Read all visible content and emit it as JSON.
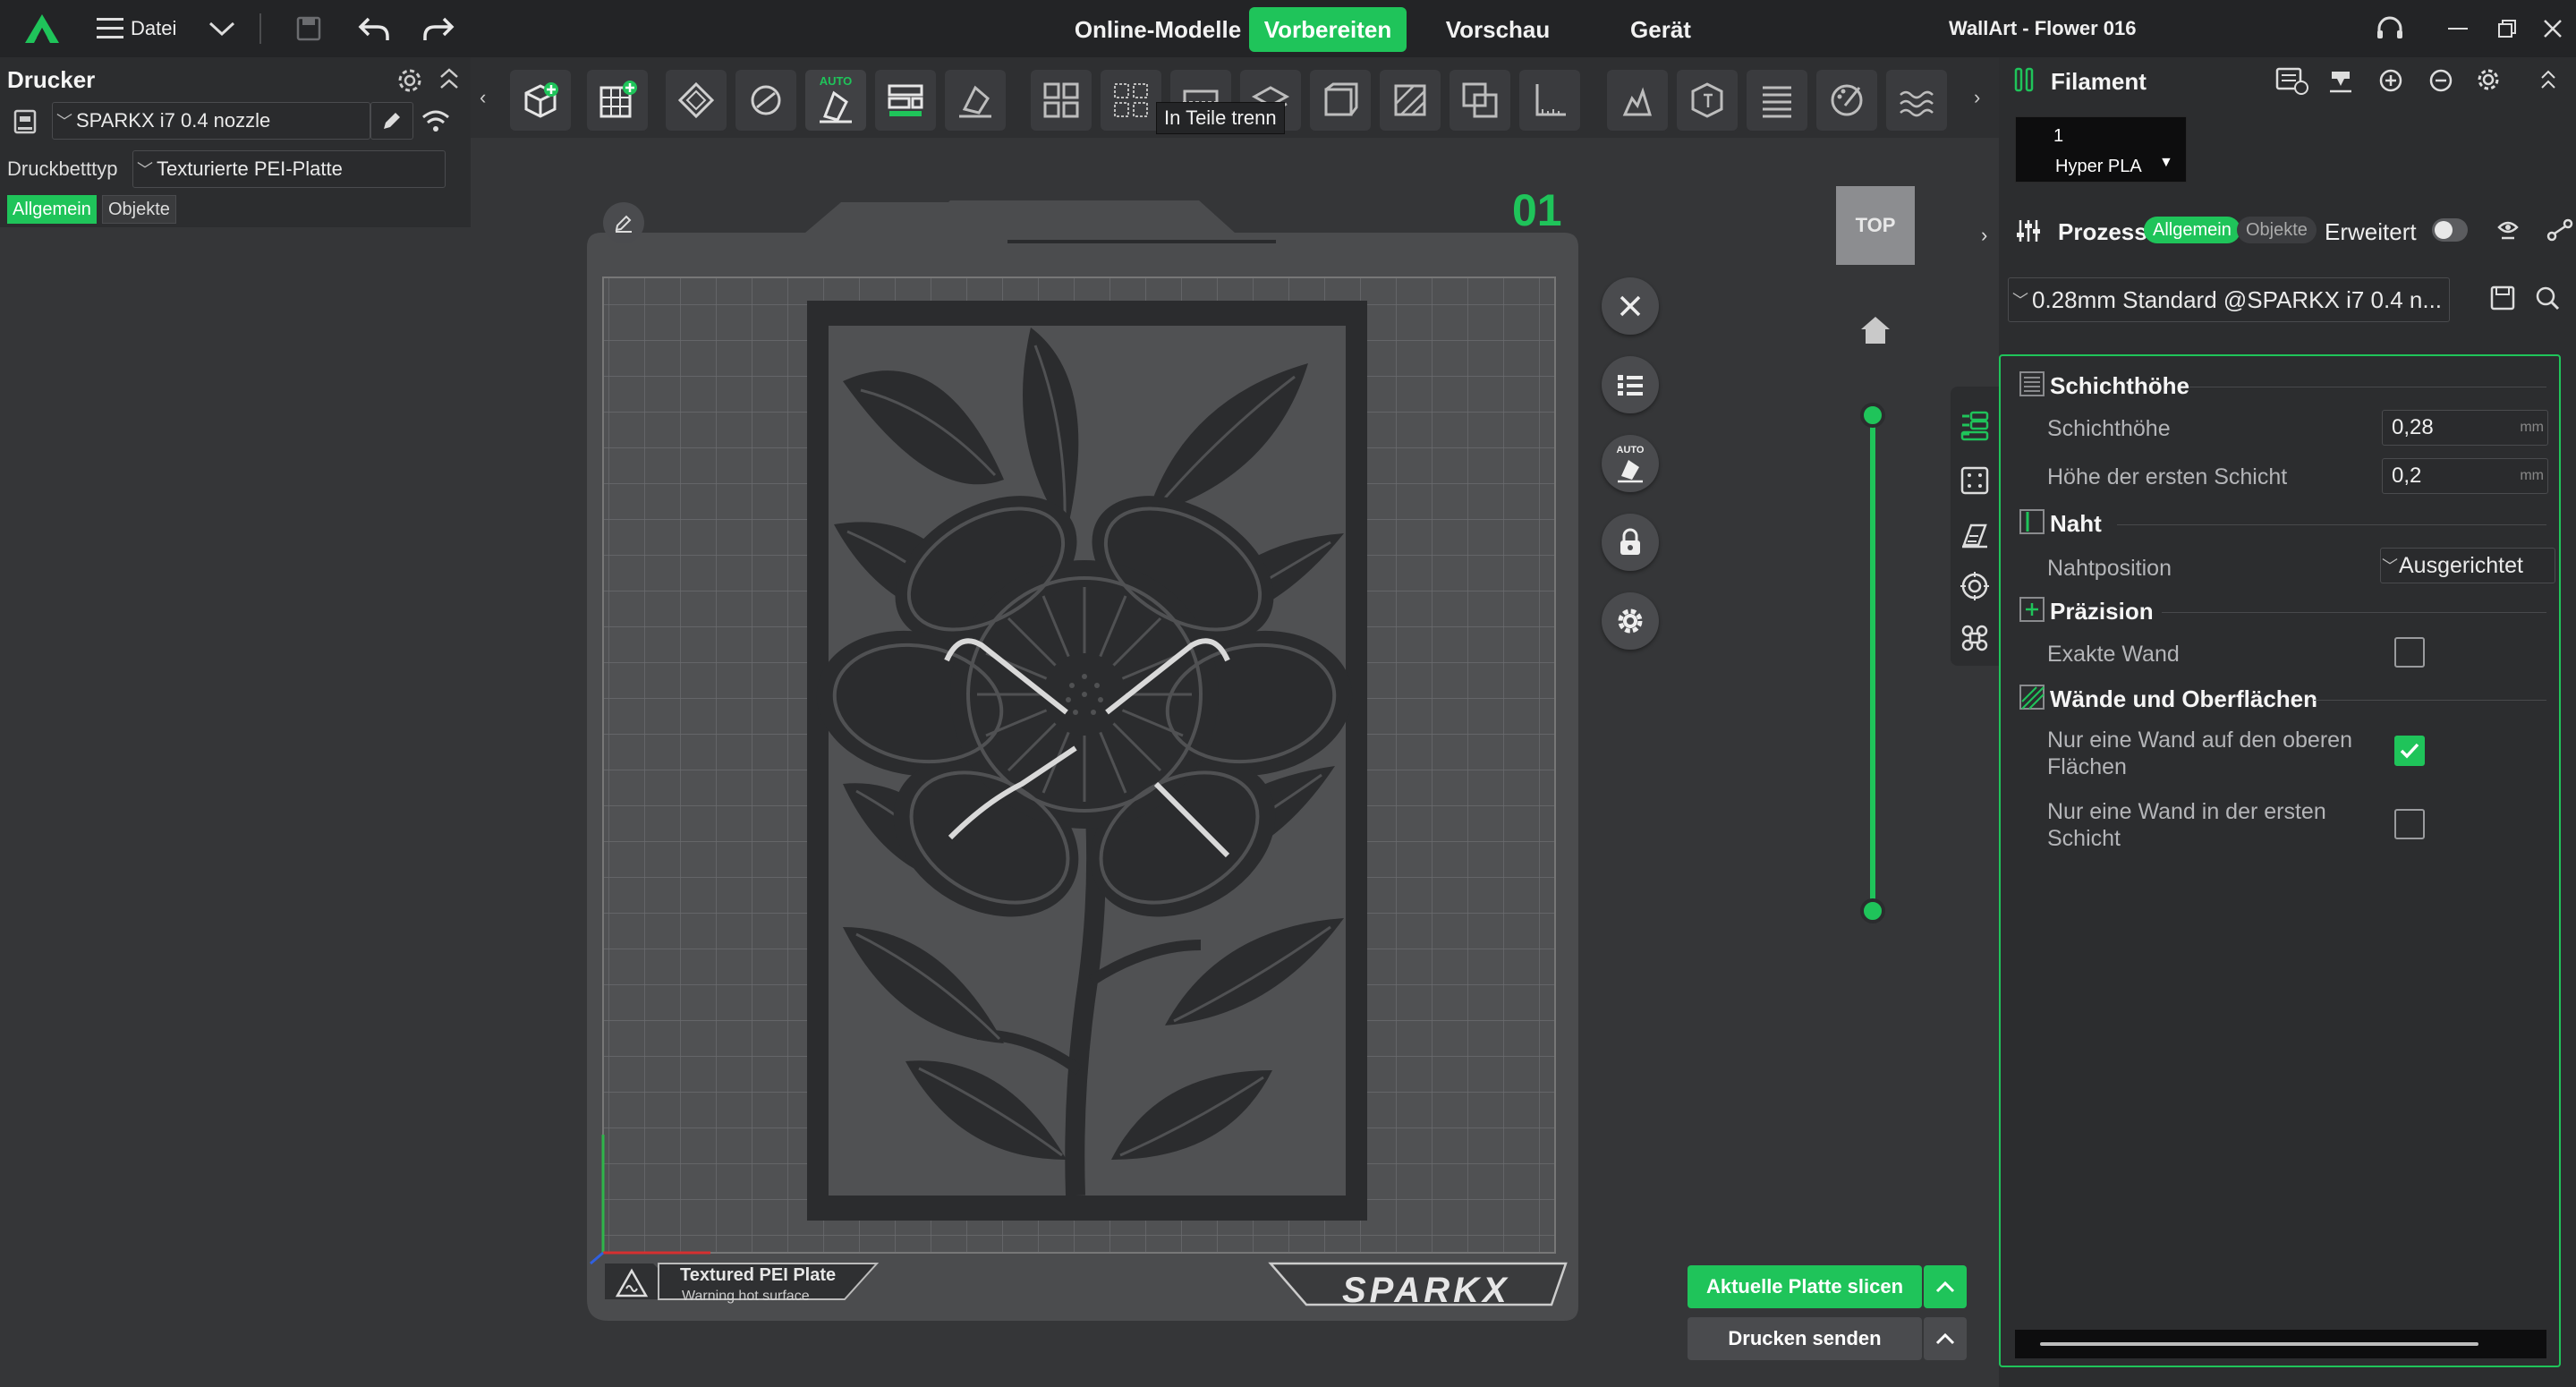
{
  "menu": {
    "file_label": "Datei"
  },
  "tabs": [
    {
      "label": "Online-Modelle"
    },
    {
      "label": "Vorbereiten"
    },
    {
      "label": "Vorschau"
    },
    {
      "label": "Gerät"
    }
  ],
  "window": {
    "title": "WallArt - Flower 016"
  },
  "printer_panel": {
    "heading": "Drucker",
    "printer_name": "SPARKX i7 0.4 nozzle",
    "bed_type_label": "Druckbetttyp",
    "bed_type_value": "Texturierte PEI-Platte",
    "tab_general": "Allgemein",
    "tab_objects": "Objekte"
  },
  "toolbar": {
    "tooltip": "In Teile trenn",
    "auto_badge": "AUTO"
  },
  "viewport": {
    "plate_number": "01",
    "view_cube_label": "TOP",
    "plate_badge_title": "Textured PEI Plate",
    "plate_badge_sub": "Warning hot surface",
    "plate_logo": "SPARKX",
    "auto_badge": "AUTO",
    "slice_button": "Aktuelle Platte slicen",
    "print_button": "Drucken senden"
  },
  "filament_panel": {
    "heading": "Filament",
    "slot_number": "1",
    "slot_material": "Hyper PLA"
  },
  "process_panel": {
    "heading": "Prozess",
    "pill_general": "Allgemein",
    "pill_objects": "Objekte",
    "advanced_label": "Erweitert",
    "preset": "0.28mm Standard @SPARKX i7 0.4 n..."
  },
  "settings": {
    "layer_height_section": "Schichthöhe",
    "layer_height_label": "Schichthöhe",
    "layer_height_value": "0,28",
    "layer_height_unit": "mm",
    "first_layer_label": "Höhe der ersten Schicht",
    "first_layer_value": "0,2",
    "first_layer_unit": "mm",
    "seam_section": "Naht",
    "seam_position_label": "Nahtposition",
    "seam_position_value": "Ausgerichtet",
    "precision_section": "Präzision",
    "precise_wall_label": "Exakte Wand",
    "precise_wall_checked": false,
    "walls_section": "Wände und Oberflächen",
    "one_wall_top_label": "Nur eine Wand auf den oberen Flächen",
    "one_wall_top_checked": true,
    "one_wall_first_label": "Nur eine Wand in der ersten Schicht",
    "one_wall_first_checked": false
  },
  "colors": {
    "accent": "#1fc45a",
    "background": "#353638",
    "panel": "#2c2d2f",
    "plate": "#4b4c4e",
    "artwork": "#2b2c2e"
  }
}
